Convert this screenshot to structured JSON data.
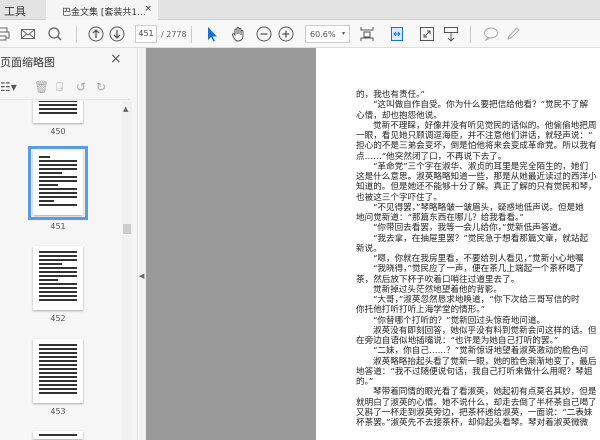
{
  "tabs": {
    "tools": "工具",
    "document": "巴金文集 [套装共1...",
    "close": "×"
  },
  "toolbar": {
    "page_current": "451",
    "page_total": "/ 2778",
    "zoom": "60.6%",
    "zoom_caret": "▾"
  },
  "sidebar": {
    "title": "页面缩略图",
    "close": "×",
    "thumbnails": [
      {
        "label": "450"
      },
      {
        "label": "451",
        "selected": true
      },
      {
        "label": "452"
      },
      {
        "label": "453"
      }
    ]
  },
  "document": {
    "lines": [
      {
        "t": "的，我也有责任。”",
        "i": false
      },
      {
        "t": "“这叫做自作自受。你为什么要把信给他看？”觉民不了解",
        "i": true
      },
      {
        "t": "心情，却也抱怨他说。",
        "i": false
      },
      {
        "t": "觉新不理睬，好像并没有听见觉民的话似的。他偷偷地把周",
        "i": true
      },
      {
        "t": "一眼，看见她只顾调逗海臣，并不注意他们讲话，就轻声说：“",
        "i": false
      },
      {
        "t": "担心的不是三弟会变坏，倒是怕他将来会变成革命党。所以我有",
        "i": false
      },
      {
        "t": "点……”他突然闭了口，不再说下去了。",
        "i": false
      },
      {
        "t": "“革命党”三个字在淑华、淑贞的耳里是完全陌生的，她们",
        "i": true
      },
      {
        "t": "这是什么意思。淑英略略知道一些，那是从她最近读过的西洋小",
        "i": false
      },
      {
        "t": "知道的。但是她还不能够十分了解。真正了解的只有觉民和琴，",
        "i": false
      },
      {
        "t": "也被这三个字吓住了。",
        "i": false
      },
      {
        "t": "“不见得罢，”琴略略皱一皱眉头，疑惑地低声说。但是她",
        "i": true
      },
      {
        "t": "地问觉新道：“那篇东西在哪儿？给我看看。”",
        "i": false
      },
      {
        "t": "“你带回去看罢，我等一会儿给你，”觉新低声答道。",
        "i": true
      },
      {
        "t": "“我去拿，在抽屉里罢？”觉民急于想看那篇文章，就站起",
        "i": true
      },
      {
        "t": "新说。",
        "i": false
      },
      {
        "t": "“嗯，你就在我房里看，不要给别人看见，”觉新小心地嘱",
        "i": true
      },
      {
        "t": "“我晓得，”觉民应了一声，便在茶几上端起一个茶杯喝了",
        "i": true
      },
      {
        "t": "茶，然后放下杯子吹着口哨往过道里去了。",
        "i": false
      },
      {
        "t": "觉新掉过头茫然地望着他的背影。",
        "i": true
      },
      {
        "t": "“大哥，”淑英忽然恳求地唤道，“你下次给三哥写信的时",
        "i": true
      },
      {
        "t": "你托他打听打听上海学堂的情形。”",
        "i": false
      },
      {
        "t": "“你替哪个打听的？”觉新回过头惊奇地问道。",
        "i": true
      },
      {
        "t": "淑英没有即刻回答，她似乎没有料到觉新会问这样的话。但",
        "i": true
      },
      {
        "t": "在旁边自语似地插嘴说：“也许是为她自己打听的罢。”",
        "i": false
      },
      {
        "t": "“二妹，你自己……？”觉新惊讶地望着淑英激动的脸色问",
        "i": true
      },
      {
        "t": "淑英略略抬起头看了觉新一眼，她的脸色渐渐地变了，最后",
        "i": true
      },
      {
        "t": "地答道：“我不过随便说句话，我自己打听来做什么用呢？琴姐",
        "i": false
      },
      {
        "t": "的。”",
        "i": false
      },
      {
        "t": "琴带着同情的眼光看了看淑英，她起初有点莫名其妙，但是",
        "i": true
      },
      {
        "t": "就明白了淑英的心情。她不说什么，却走去倒了半杯茶自己喝了",
        "i": false
      },
      {
        "t": "又斟了一杯走到淑英旁边，把茶杯递给淑英，一面说：“二表妹",
        "i": false
      },
      {
        "t": "杯茶罢。”淑英先不去接茶杯，却仰起头看琴。琴对着淑英微微",
        "i": false
      }
    ]
  },
  "colors": {
    "accent": "#5a9be6",
    "gray_area": "#999999",
    "select_tool": "#1a6fd1"
  }
}
